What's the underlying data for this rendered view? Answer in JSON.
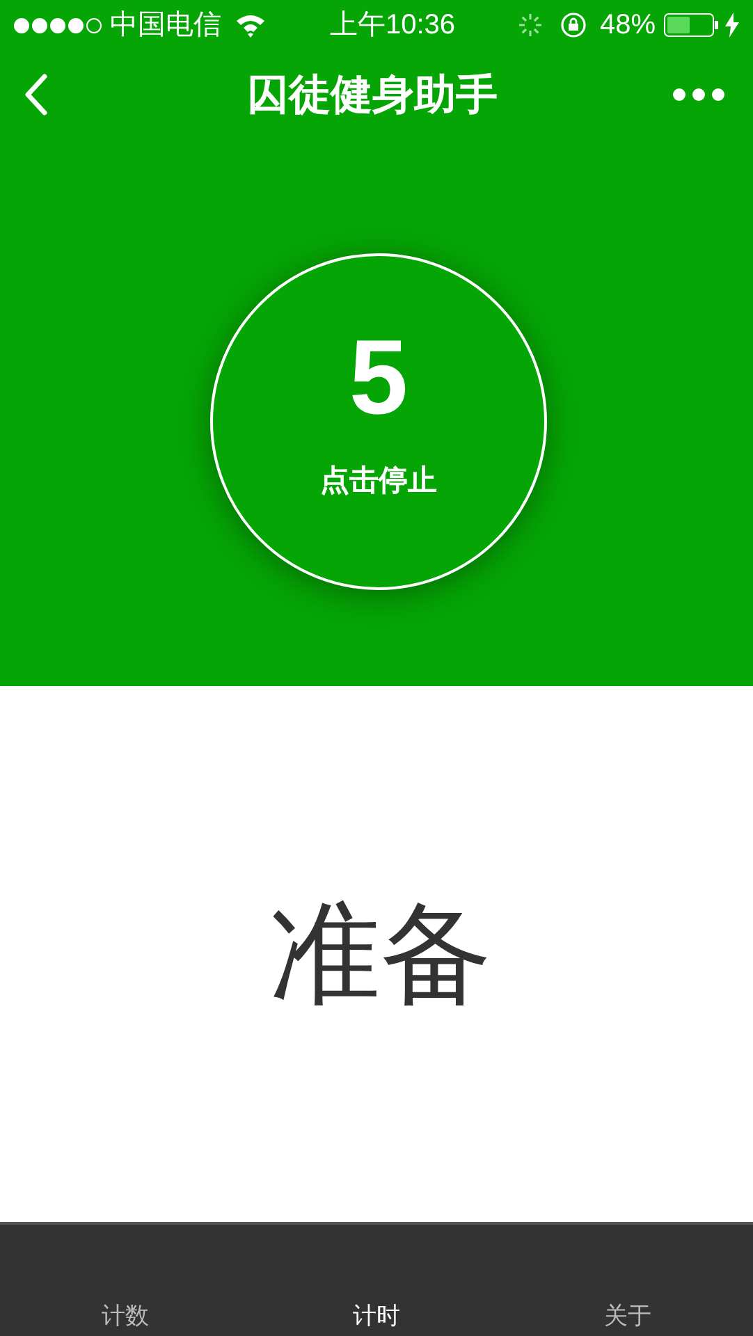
{
  "status_bar": {
    "carrier": "中国电信",
    "time": "上午10:36",
    "battery": "48%"
  },
  "nav_bar": {
    "title": "囚徒健身助手"
  },
  "timer": {
    "count": "5",
    "action": "点击停止"
  },
  "phase": "准备",
  "tab_bar": [
    {
      "label": "计数",
      "selected": false
    },
    {
      "label": "计时",
      "selected": true
    },
    {
      "label": "关于",
      "selected": false
    }
  ]
}
